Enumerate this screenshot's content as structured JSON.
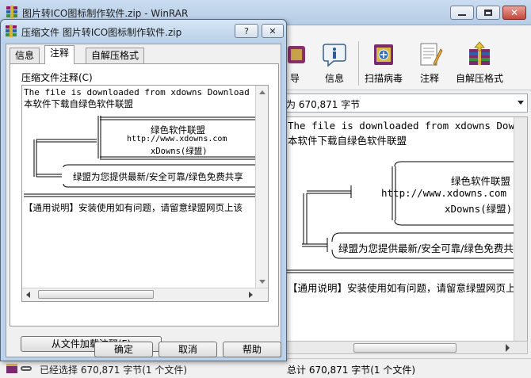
{
  "main_window": {
    "title": "图片转ICO图标制作软件.zip - WinRAR",
    "toolbar": [
      {
        "label": "导",
        "icon": "delete-icon"
      },
      {
        "label": "信息",
        "icon": "info-icon"
      },
      {
        "label": "扫描病毒",
        "icon": "virus-scan-icon"
      },
      {
        "label": "注释",
        "icon": "comment-icon"
      },
      {
        "label": "自解压格式",
        "icon": "sfx-icon"
      }
    ],
    "path_text": "为 670,871 字节",
    "comment_lines": {
      "l1": "The file is downloaded from xdowns Download Site",
      "l2": "本软件下载自绿色软件联盟",
      "l3": "绿色软件联盟",
      "l4": "http://www.xdowns.com",
      "l5": "xDowns(绿盟)",
      "l6": "绿盟为您提供最新/安全可靠/绿色免费共享",
      "l7": "【通用说明】安装使用如有问题，请留意绿盟网页上该"
    },
    "status": "总计 670,871 字节(1 个文件)",
    "status_left": "已经选择 670,871 字节(1 个文件)"
  },
  "dialog": {
    "title": "压缩文件 图片转ICO图标制作软件.zip",
    "help_glyph": "?",
    "close_glyph": "✕",
    "tabs": [
      "信息",
      "注释",
      "自解压格式"
    ],
    "active_tab": "注释",
    "group_label": "压缩文件注释(C)",
    "comment_lines": {
      "l1": "The file is downloaded from xdowns Download Site",
      "l2": "本软件下载自绿色软件联盟",
      "l3": "绿色软件联盟",
      "l4": "http://www.xdowns.com",
      "l5": "xDowns(绿盟)",
      "l6": "绿盟为您提供最新/安全可靠/绿色免费共享",
      "l7": "【通用说明】安装使用如有问题，请留意绿盟网页上该"
    },
    "load_button": "从文件加载注释(F)",
    "ok_button": "确定",
    "cancel_button": "取消",
    "help_button": "帮助"
  }
}
